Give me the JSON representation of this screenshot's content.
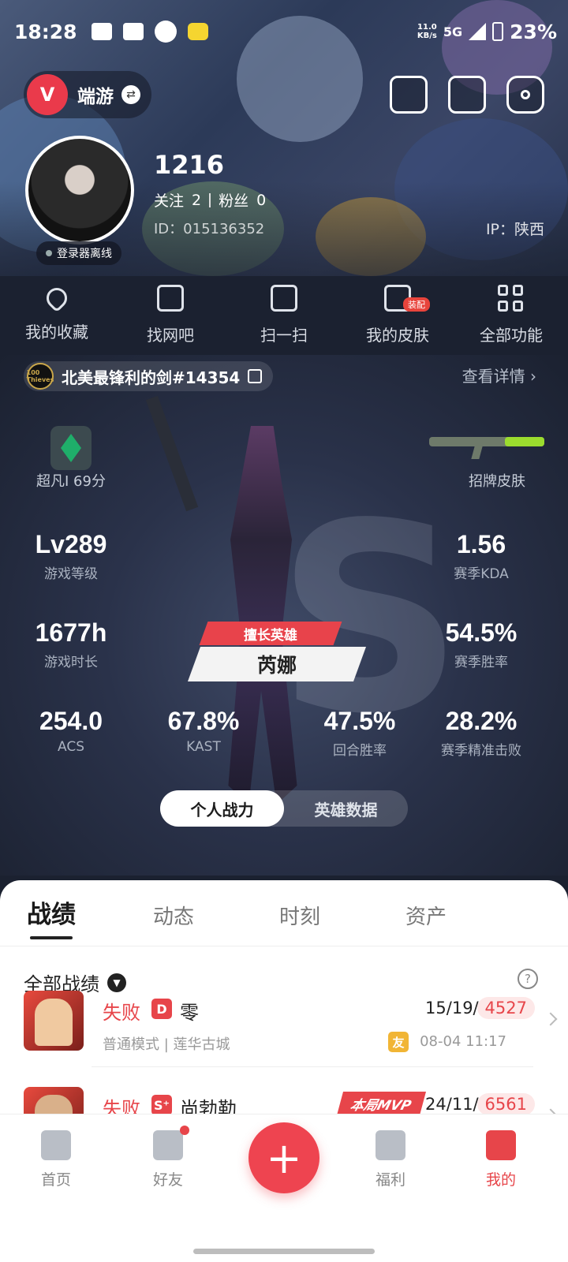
{
  "status_bar": {
    "time": "18:28",
    "net_speed_top": "11.0",
    "net_speed_unit": "KB/s",
    "network": "5G",
    "battery": "23%"
  },
  "header": {
    "app_name": "端游",
    "app_logo_letter": "V"
  },
  "profile": {
    "name": "1216",
    "follow_label": "关注",
    "follow_count": "2",
    "fans_label": "粉丝",
    "fans_count": "0",
    "id": "ID：015136352",
    "ip": "IP：陕西",
    "login_status": "登录器离线"
  },
  "quick_actions": [
    {
      "label": "我的收藏",
      "icon": "heart-icon"
    },
    {
      "label": "找网吧",
      "icon": "monitor-icon"
    },
    {
      "label": "扫一扫",
      "icon": "scan-icon"
    },
    {
      "label": "我的皮肤",
      "icon": "skin-icon",
      "tag": "装配"
    },
    {
      "label": "全部功能",
      "icon": "grid-icon"
    }
  ],
  "riot": {
    "account": "北美最锋利的剑#14354",
    "badge": "100 Thieves",
    "detail_link": "查看详情 ›"
  },
  "rank": {
    "label": "超凡I 69分"
  },
  "skin": {
    "label": "招牌皮肤"
  },
  "stats": {
    "level": {
      "value": "Lv289",
      "label": "游戏等级"
    },
    "kda": {
      "value": "1.56",
      "label": "赛季KDA"
    },
    "hours": {
      "value": "1677h",
      "label": "游戏时长"
    },
    "winrate": {
      "value": "54.5%",
      "label": "赛季胜率"
    },
    "acs": {
      "value": "254.0",
      "label": "ACS"
    },
    "kast": {
      "value": "67.8%",
      "label": "KAST"
    },
    "round_win": {
      "value": "47.5%",
      "label": "回合胜率"
    },
    "headshot": {
      "value": "28.2%",
      "label": "赛季精准击败"
    }
  },
  "hero": {
    "tag": "擅长英雄",
    "name": "芮娜"
  },
  "segments": {
    "personal": "个人战力",
    "heroes": "英雄数据"
  },
  "tabs": [
    "战绩",
    "动态",
    "时刻",
    "资产"
  ],
  "records_filter": "全部战绩",
  "records": [
    {
      "result": "失败",
      "rank_letter": "D",
      "agent": "零",
      "mode": "普通模式 | 莲华古城",
      "kda": "15/19/3",
      "score": "4527",
      "friend_tag": "友",
      "date": "08-04 11:17"
    },
    {
      "result": "失败",
      "rank_letter": "S⁺",
      "agent": "尚勃勒",
      "mvp": "本局MVP",
      "kda": "24/11/2",
      "score": "6561"
    }
  ],
  "nav": {
    "home": "首页",
    "friends": "好友",
    "welfare": "福利",
    "mine": "我的",
    "fab": "+"
  },
  "colors": {
    "accent": "#ee4450",
    "defeat": "#e7454a",
    "friend_tag": "#f1b535"
  }
}
